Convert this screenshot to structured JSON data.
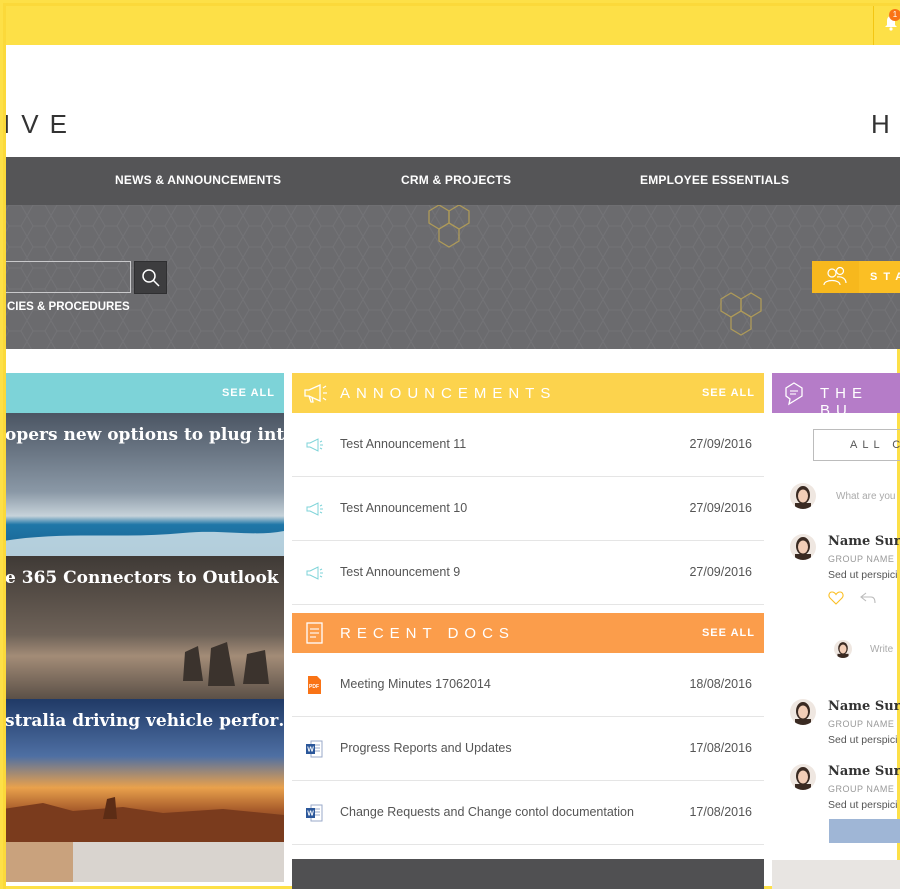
{
  "notifications": {
    "badge": "1"
  },
  "brand": {
    "left_text": "IVE",
    "right_text": "H"
  },
  "nav": {
    "items": [
      "NEWS & ANNOUNCEMENTS",
      "CRM & PROJECTS",
      "EMPLOYEE ESSENTIALS"
    ]
  },
  "hero": {
    "search_placeholder": "",
    "policies_link": "CIES & PROCEDURES",
    "staff_button": "STA"
  },
  "news": {
    "see_all": "SEE ALL",
    "tiles": [
      {
        "caption": "opers new options to plug int…"
      },
      {
        "caption": "e 365 Connectors to Outlook …"
      },
      {
        "caption": "stralia driving vehicle perfor…"
      }
    ]
  },
  "announcements": {
    "title": "ANNOUNCEMENTS",
    "see_all": "SEE ALL",
    "items": [
      {
        "title": "Test Announcement 11",
        "date": "27/09/2016"
      },
      {
        "title": "Test Announcement 10",
        "date": "27/09/2016"
      },
      {
        "title": "Test Announcement 9",
        "date": "27/09/2016"
      }
    ]
  },
  "recent_docs": {
    "title": "RECENT DOCS",
    "see_all": "SEE ALL",
    "items": [
      {
        "title": "Meeting Minutes 17062014",
        "date": "18/08/2016",
        "icon": "pdf-icon"
      },
      {
        "title": "Progress Reports and Updates",
        "date": "17/08/2016",
        "icon": "word-icon"
      },
      {
        "title": "Change Requests and Change contol documentation",
        "date": "17/08/2016",
        "icon": "word-icon"
      }
    ]
  },
  "buzz": {
    "title": "THE BU",
    "filter": "ALL C",
    "compose_placeholder": "What are you",
    "reply_placeholder": "Write",
    "posts": [
      {
        "name": "Name Surna",
        "group": "GROUP NAME",
        "text": "Sed ut perspici"
      },
      {
        "name": "Name Surna",
        "group": "GROUP NAME",
        "text": "Sed ut perspici"
      },
      {
        "name": "Name Surna",
        "group": "GROUP NAME",
        "text": "Sed ut perspici"
      }
    ]
  },
  "colors": {
    "topbar": "#fde047",
    "nav": "#555557",
    "news_header": "#7dd3d8",
    "announcements_header": "#fcd34d",
    "docs_header": "#fb9d4b",
    "buzz_header": "#b57cc8"
  }
}
